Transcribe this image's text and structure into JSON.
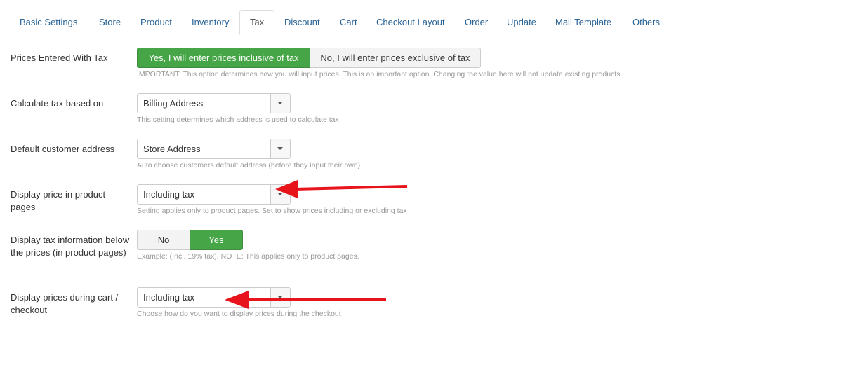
{
  "tabs": [
    {
      "label": "Basic Settings"
    },
    {
      "label": "Store"
    },
    {
      "label": "Product"
    },
    {
      "label": "Inventory"
    },
    {
      "label": "Tax"
    },
    {
      "label": "Discount"
    },
    {
      "label": "Cart"
    },
    {
      "label": "Checkout Layout"
    },
    {
      "label": "Order"
    },
    {
      "label": "Update"
    },
    {
      "label": "Mail Template"
    },
    {
      "label": "Others"
    }
  ],
  "active_tab": "Tax",
  "settings": {
    "prices_with_tax": {
      "label": "Prices Entered With Tax",
      "option_yes": "Yes, I will enter prices inclusive of tax",
      "option_no": "No, I will enter prices exclusive of tax",
      "selected": "yes",
      "help": "IMPORTANT: This option determines how you will input prices. This is an important option. Changing the value here will not update existing products"
    },
    "calculate_tax": {
      "label": "Calculate tax based on",
      "value": "Billing Address",
      "help": "This setting determines which address is used to calculate tax"
    },
    "default_address": {
      "label": "Default customer address",
      "value": "Store Address",
      "help": "Auto choose customers default address (before they input their own)"
    },
    "display_price_product": {
      "label": "Display price in product pages",
      "value": "Including tax",
      "help": "Setting applies only to product pages. Set to show prices including or excluding tax"
    },
    "display_tax_info": {
      "label": "Display tax information below the prices (in product pages)",
      "option_no": "No",
      "option_yes": "Yes",
      "selected": "yes",
      "help": "Example: (Incl. 19% tax). NOTE: This applies only to product pages."
    },
    "display_price_cart": {
      "label": "Display prices during cart / checkout",
      "value": "Including tax",
      "help": "Choose how do you want to display prices during the checkout"
    }
  },
  "colors": {
    "link": "#2a6496",
    "active_green": "#46a546",
    "annotation_arrow": "#e8141b"
  },
  "icons": {
    "select_caret": "chevron-down-icon",
    "annotation": "red-arrow-icon"
  }
}
